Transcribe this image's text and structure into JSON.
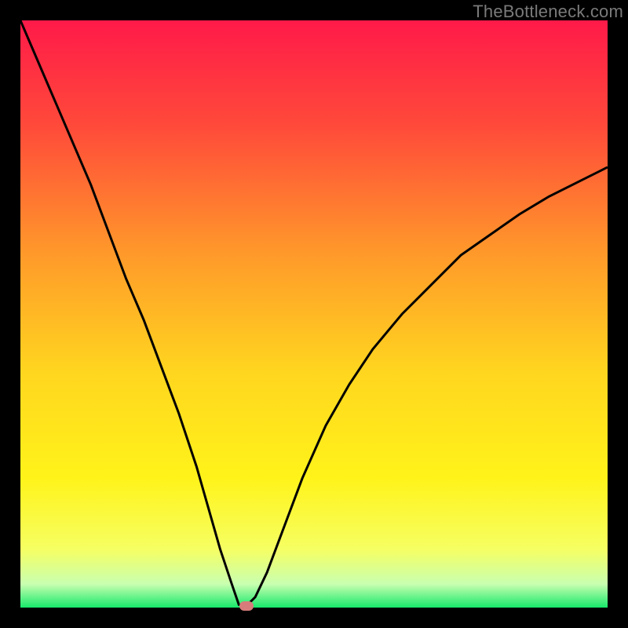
{
  "watermark": "TheBottleneck.com",
  "chart_data": {
    "type": "line",
    "title": "",
    "xlabel": "",
    "ylabel": "",
    "xlim": [
      0,
      100
    ],
    "ylim": [
      0,
      100
    ],
    "grid": false,
    "legend": false,
    "background_gradient": {
      "stops": [
        {
          "pos": 0.0,
          "color": "#ff1a49"
        },
        {
          "pos": 0.18,
          "color": "#ff4a3a"
        },
        {
          "pos": 0.4,
          "color": "#ff9a2a"
        },
        {
          "pos": 0.6,
          "color": "#ffd61f"
        },
        {
          "pos": 0.78,
          "color": "#fff31a"
        },
        {
          "pos": 0.9,
          "color": "#f6ff62"
        },
        {
          "pos": 0.96,
          "color": "#c9ffb0"
        },
        {
          "pos": 1.0,
          "color": "#17e86b"
        }
      ]
    },
    "series": [
      {
        "name": "bottleneck-curve",
        "color": "#000000",
        "x": [
          0,
          3,
          6,
          9,
          12,
          15,
          18,
          21,
          24,
          27,
          30,
          32,
          34,
          36,
          37.2,
          38.5,
          40,
          42,
          45,
          48,
          52,
          56,
          60,
          65,
          70,
          75,
          80,
          85,
          90,
          95,
          100
        ],
        "y": [
          100,
          93,
          86,
          79,
          72,
          64,
          56,
          49,
          41,
          33,
          24,
          17,
          10,
          4,
          0.5,
          0.3,
          1.8,
          6,
          14,
          22,
          31,
          38,
          44,
          50,
          55,
          60,
          63.5,
          67,
          70,
          72.5,
          75
        ]
      }
    ],
    "marker": {
      "x": 38.5,
      "y": 0.3,
      "color": "#d87b7b"
    }
  }
}
